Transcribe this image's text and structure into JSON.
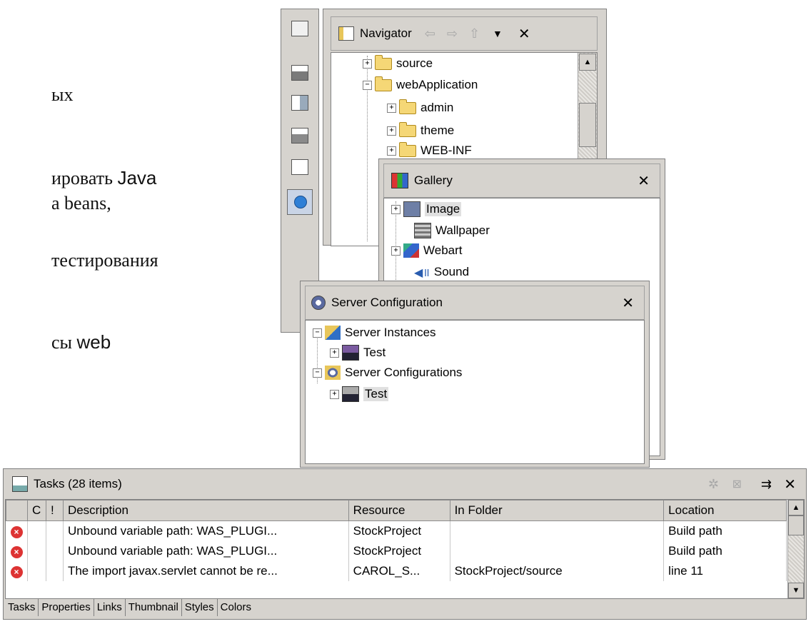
{
  "background_text": {
    "line1": "ых",
    "line2_a": "ировать ",
    "line2_b": "Java",
    "line3": "a beans,",
    "line4": "тестирования",
    "line5_a": "сы ",
    "line5_b": "web"
  },
  "left_toolbar": {
    "icons": [
      "new-view-icon",
      "server-view-icon",
      "data-view-icon",
      "web-view-icon",
      "page-view-icon",
      "globe-view-icon"
    ]
  },
  "navigator": {
    "title": "Navigator",
    "nodes": [
      {
        "label": "source",
        "expander": "+"
      },
      {
        "label": "webApplication",
        "expander": "−"
      },
      {
        "label": "admin",
        "expander": "+"
      },
      {
        "label": "theme",
        "expander": "+"
      },
      {
        "label": "WEB-INF",
        "expander": "+"
      }
    ]
  },
  "gallery": {
    "title": "Gallery",
    "nodes": [
      {
        "label": "Image",
        "expander": "+"
      },
      {
        "label": "Wallpaper",
        "expander": ""
      },
      {
        "label": "Webart",
        "expander": "+"
      },
      {
        "label": "Sound",
        "expander": ""
      }
    ]
  },
  "server_config": {
    "title": "Server Configuration",
    "nodes": [
      {
        "label": "Server Instances",
        "expander": "−"
      },
      {
        "label": "Test",
        "expander": "+"
      },
      {
        "label": "Server Configurations",
        "expander": "−"
      },
      {
        "label": "Test",
        "expander": "+"
      }
    ]
  },
  "tasks": {
    "title": "Tasks (28 items)",
    "columns": [
      "",
      "C",
      "!",
      "Description",
      "Resource",
      "In Folder",
      "Location"
    ],
    "rows": [
      {
        "description": "Unbound variable path: WAS_PLUGI...",
        "resource": "StockProject",
        "folder": "",
        "location": "Build path"
      },
      {
        "description": "Unbound variable path: WAS_PLUGI...",
        "resource": "StockProject",
        "folder": "",
        "location": "Build path"
      },
      {
        "description": "The import javax.servlet cannot be re...",
        "resource": "CAROL_S...",
        "folder": "StockProject/source",
        "location": "line 11"
      }
    ],
    "tabs": [
      "Tasks",
      "Properties",
      "Links",
      "Thumbnail",
      "Styles",
      "Colors"
    ]
  }
}
